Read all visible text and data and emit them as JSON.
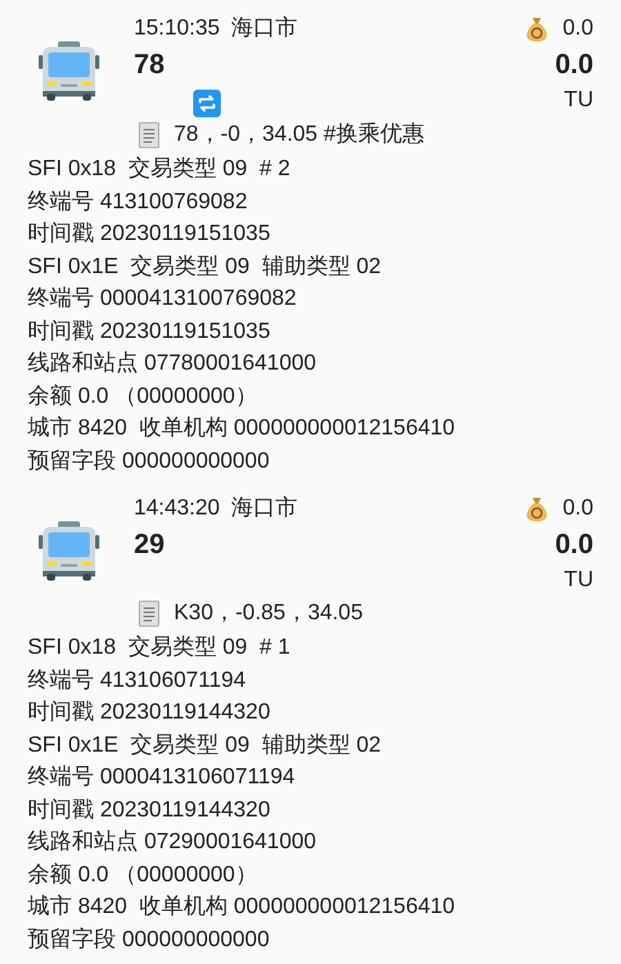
{
  "records": [
    {
      "time": "15:10:35",
      "city": "海口市",
      "route": "78",
      "balance": "0.0",
      "amount": "0.0",
      "unit": "TU",
      "transfer": true,
      "memo": "78，-0，34.05 #换乘优惠",
      "details": [
        "SFI 0x18  交易类型 09  # 2",
        "终端号 413100769082",
        "时间戳 20230119151035",
        "SFI 0x1E  交易类型 09  辅助类型 02",
        "终端号 0000413100769082",
        "时间戳 20230119151035",
        "线路和站点 07780001641000",
        "余额 0.0 （00000000）",
        "城市 8420  收单机构 000000000012156410",
        "预留字段 000000000000"
      ]
    },
    {
      "time": "14:43:20",
      "city": "海口市",
      "route": "29",
      "balance": "0.0",
      "amount": "0.0",
      "unit": "TU",
      "transfer": false,
      "memo": "K30，-0.85，34.05",
      "details": [
        "SFI 0x18  交易类型 09  # 1",
        "终端号 413106071194",
        "时间戳 20230119144320",
        "SFI 0x1E  交易类型 09  辅助类型 02",
        "终端号 0000413106071194",
        "时间戳 20230119144320",
        "线路和站点 07290001641000",
        "余额 0.0 （00000000）",
        "城市 8420  收单机构 000000000012156410",
        "预留字段 000000000000"
      ]
    }
  ]
}
